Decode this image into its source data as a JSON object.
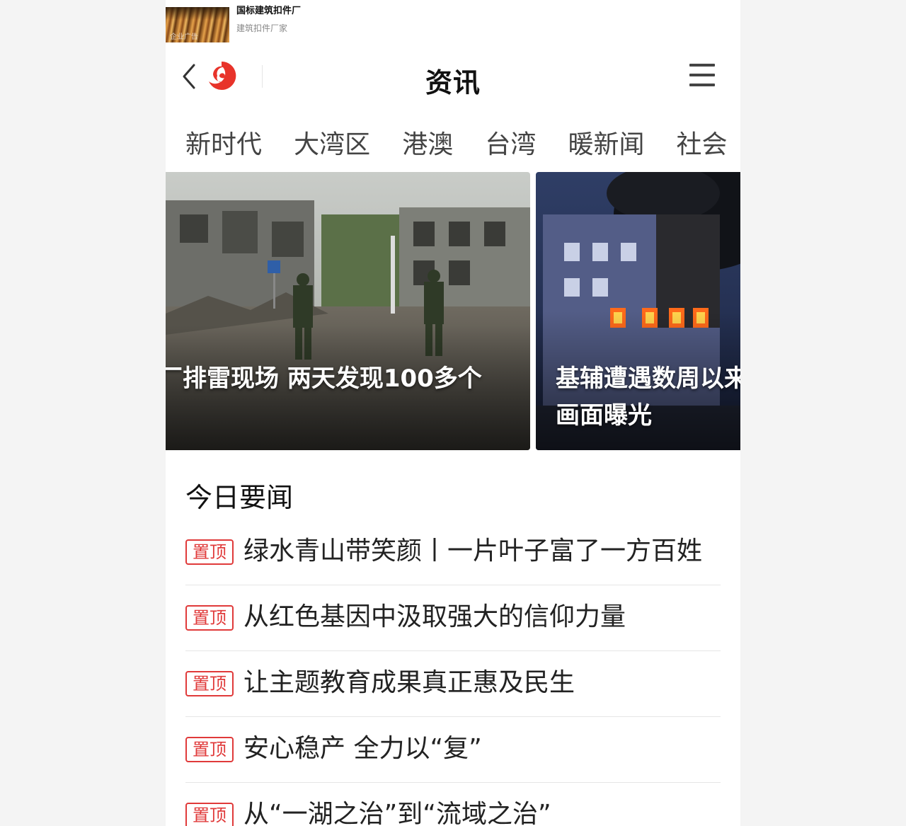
{
  "ad": {
    "title": "国标建筑扣件厂",
    "subtitle": "建筑扣件厂家",
    "thumb_watermark": "企业广告"
  },
  "header": {
    "title": "资讯",
    "back_icon": "chevron-left-icon",
    "logo_icon": "phoenix-logo-icon",
    "menu_icon": "hamburger-menu-icon"
  },
  "tabs": [
    "新时代",
    "大湾区",
    "港澳",
    "台湾",
    "暖新闻",
    "社会"
  ],
  "carousel": {
    "slides": [
      {
        "caption": "厂排雷现场 两天发现100多个"
      },
      {
        "caption": "基辅遭遇数周以来画面曝光"
      }
    ]
  },
  "section": {
    "title": "今日要闻",
    "pin_label": "置顶"
  },
  "news": [
    {
      "title": "绿水青山带笑颜丨一片叶子富了一方百姓"
    },
    {
      "title": "从红色基因中汲取强大的信仰力量"
    },
    {
      "title": "让主题教育成果真正惠及民生"
    },
    {
      "title": "安心稳产 全力以“复”"
    },
    {
      "title": "从“一湖之治”到“流域之治”"
    }
  ],
  "colors": {
    "accent_red": "#e03a3a",
    "logo_red": "#e8332a",
    "background": "#f4f4f4"
  }
}
